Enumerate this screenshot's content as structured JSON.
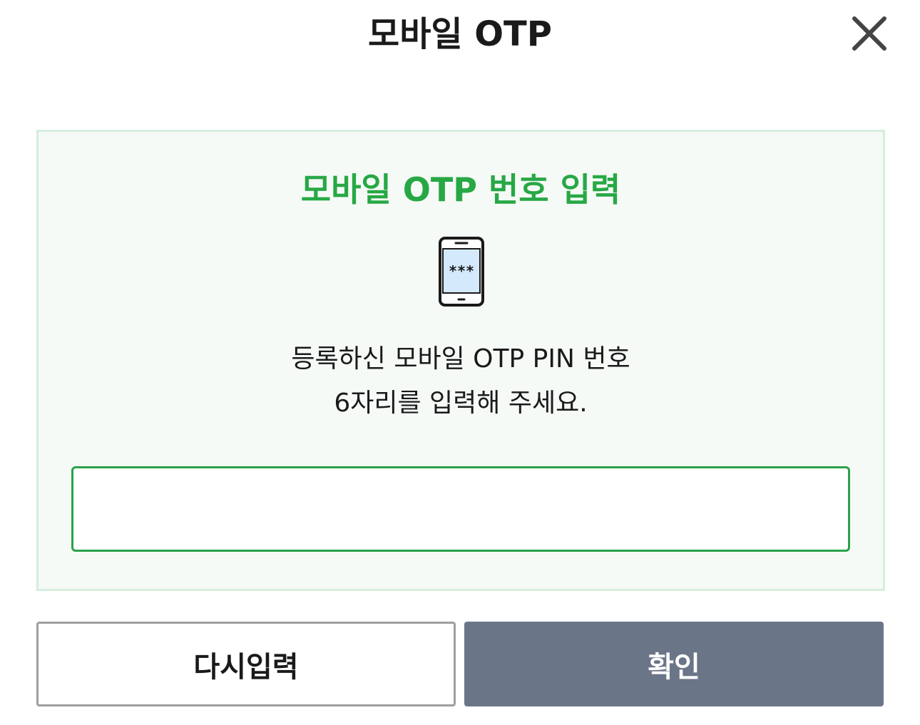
{
  "header": {
    "title": "모바일 OTP",
    "close_icon": "close-icon"
  },
  "panel": {
    "title": "모바일 OTP 번호 입력",
    "icon": "mobile-phone-icon",
    "phone_screen_text": "***",
    "description_line1": "등록하신 모바일 OTP PIN 번호",
    "description_line2": "6자리를 입력해 주세요.",
    "pin_input_value": "",
    "pin_input_placeholder": ""
  },
  "buttons": {
    "reset_label": "다시입력",
    "confirm_label": "확인"
  },
  "colors": {
    "accent_green": "#27a845",
    "panel_bg": "#f5faf6",
    "panel_border": "#d6eedd",
    "input_border": "#2aa24a",
    "confirm_bg": "#6b7588",
    "reset_border": "#9e9e9e",
    "phone_screen": "#d4e9fb"
  }
}
